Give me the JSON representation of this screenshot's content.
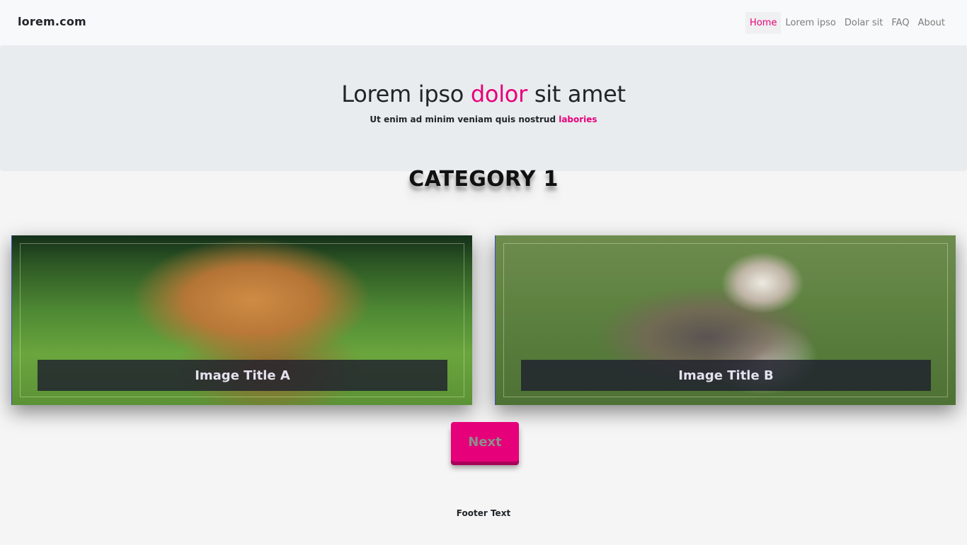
{
  "navbar": {
    "brand": "lorem.com",
    "items": [
      {
        "label": "Home",
        "active": true
      },
      {
        "label": "Lorem ipso",
        "active": false
      },
      {
        "label": "Dolar sit",
        "active": false
      },
      {
        "label": "FAQ",
        "active": false
      },
      {
        "label": "About",
        "active": false
      }
    ]
  },
  "hero": {
    "title_before": "Lorem ipso ",
    "title_accent": "dolor",
    "title_after": " sit amet",
    "subtitle_before": "Ut enim ad minim veniam quis nostrud ",
    "subtitle_accent": "labories"
  },
  "category": {
    "heading": "CATEGORY 1"
  },
  "cards": [
    {
      "title": "Image Title A",
      "image": "golden-retriever-photo"
    },
    {
      "title": "Image Title B",
      "image": "beagle-puppy-photo"
    }
  ],
  "next_button": {
    "label": "Next"
  },
  "footer": {
    "text": "Footer Text"
  },
  "colors": {
    "accent": "#e6007a",
    "navbar_bg": "#f8f9fa",
    "hero_bg": "#e9ecef",
    "page_bg": "#f5f5f5"
  }
}
